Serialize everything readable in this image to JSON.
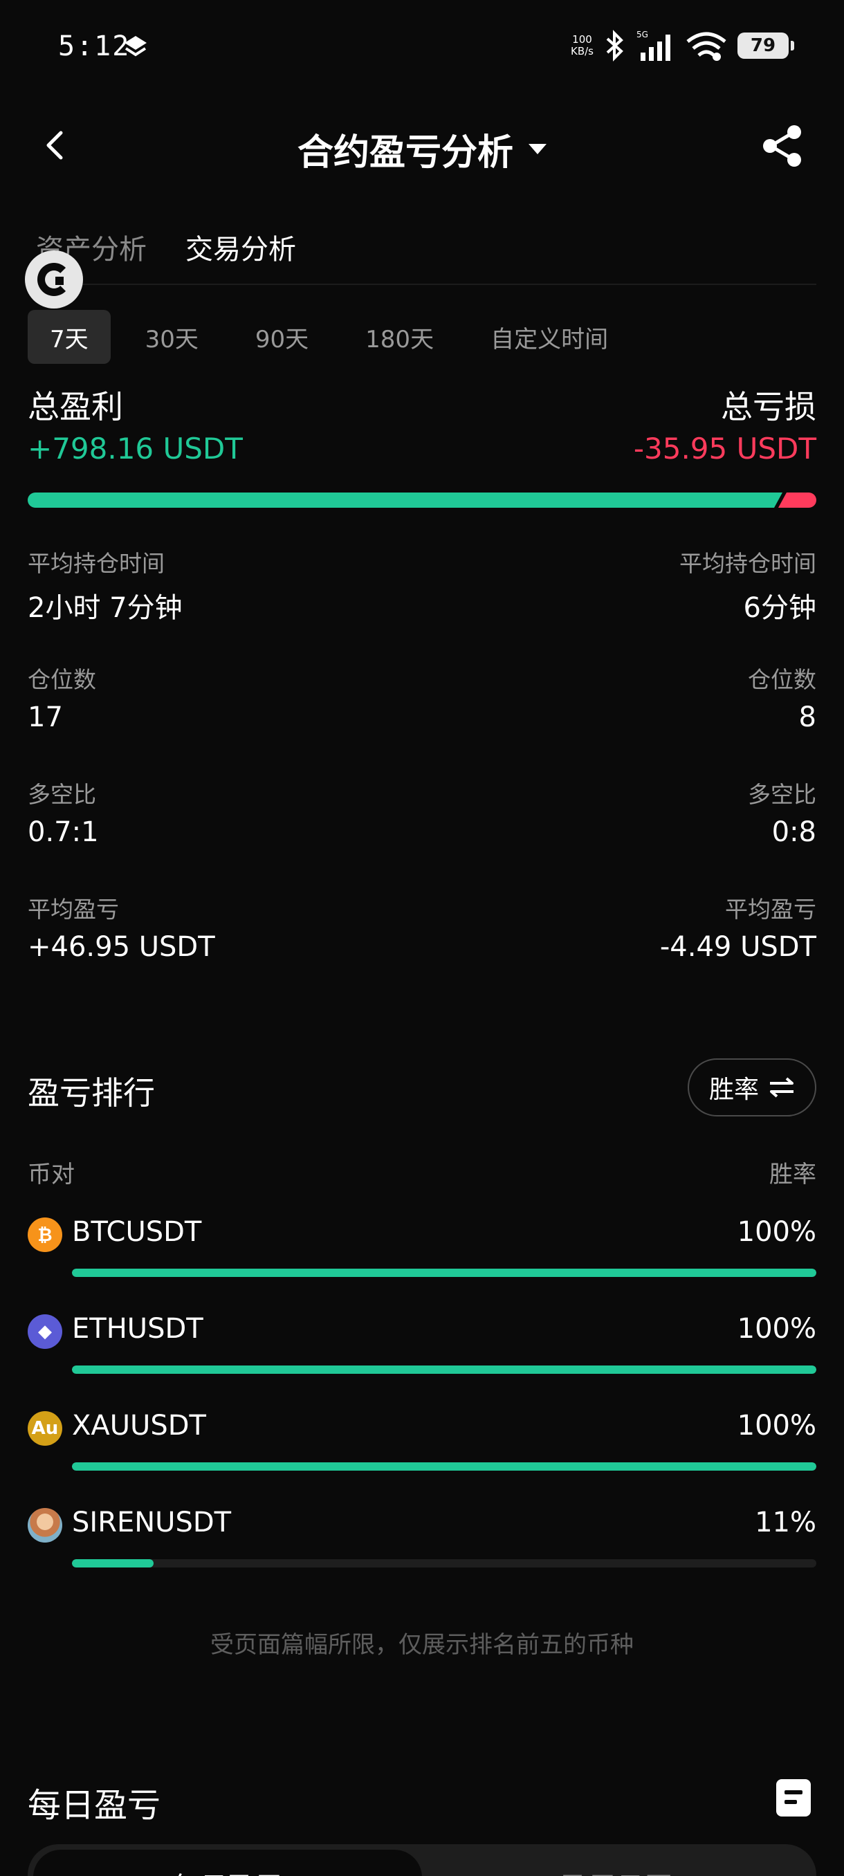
{
  "status_bar": {
    "time": "5:12",
    "net_speed_value": "100",
    "net_speed_unit": "KB/s",
    "battery": "79"
  },
  "header": {
    "title": "合约盈亏分析"
  },
  "sub_tabs": {
    "asset": "资产分析",
    "trade": "交易分析"
  },
  "periods": [
    "7天",
    "30天",
    "90天",
    "180天",
    "自定义时间"
  ],
  "summary": {
    "profit_label": "总盈利",
    "profit_value": "+798.16 USDT",
    "loss_label": "总亏损",
    "loss_value": "-35.95 USDT",
    "profit_share": 0.957
  },
  "stats": [
    {
      "label_left": "平均持仓时间",
      "value_left": "2小时 7分钟",
      "label_right": "平均持仓时间",
      "value_right": "6分钟"
    },
    {
      "label_left": "仓位数",
      "value_left": "17",
      "label_right": "仓位数",
      "value_right": "8"
    },
    {
      "label_left": "多空比",
      "value_left": "0.7:1",
      "label_right": "多空比",
      "value_right": "0:8"
    },
    {
      "label_left": "平均盈亏",
      "value_left": "+46.95 USDT",
      "label_right": "平均盈亏",
      "value_right": "-4.49 USDT"
    }
  ],
  "ranking": {
    "title": "盈亏排行",
    "toggle_label": "胜率",
    "col_pair": "币对",
    "col_rate": "胜率",
    "rows": [
      {
        "pair": "BTCUSDT",
        "rate": "100%",
        "fraction": 1.0,
        "icon": "bitcoin-icon",
        "icon_text": "₿",
        "color": "#f7931a"
      },
      {
        "pair": "ETHUSDT",
        "rate": "100%",
        "fraction": 1.0,
        "icon": "ethereum-icon",
        "icon_text": "◆",
        "color": "#5b5bd6"
      },
      {
        "pair": "XAUUSDT",
        "rate": "100%",
        "fraction": 1.0,
        "icon": "gold-icon",
        "icon_text": "Au",
        "color": "#d4a017"
      },
      {
        "pair": "SIRENUSDT",
        "rate": "11%",
        "fraction": 0.11,
        "icon": "siren-avatar-icon",
        "icon_text": "",
        "color": "#c9875f"
      }
    ],
    "footnote": "受页面篇幅所限，仅展示排名前五的币种"
  },
  "daily": {
    "title": "每日盈亏",
    "tab_daily": "每日盈亏",
    "tab_calendar": "盈亏日历"
  }
}
